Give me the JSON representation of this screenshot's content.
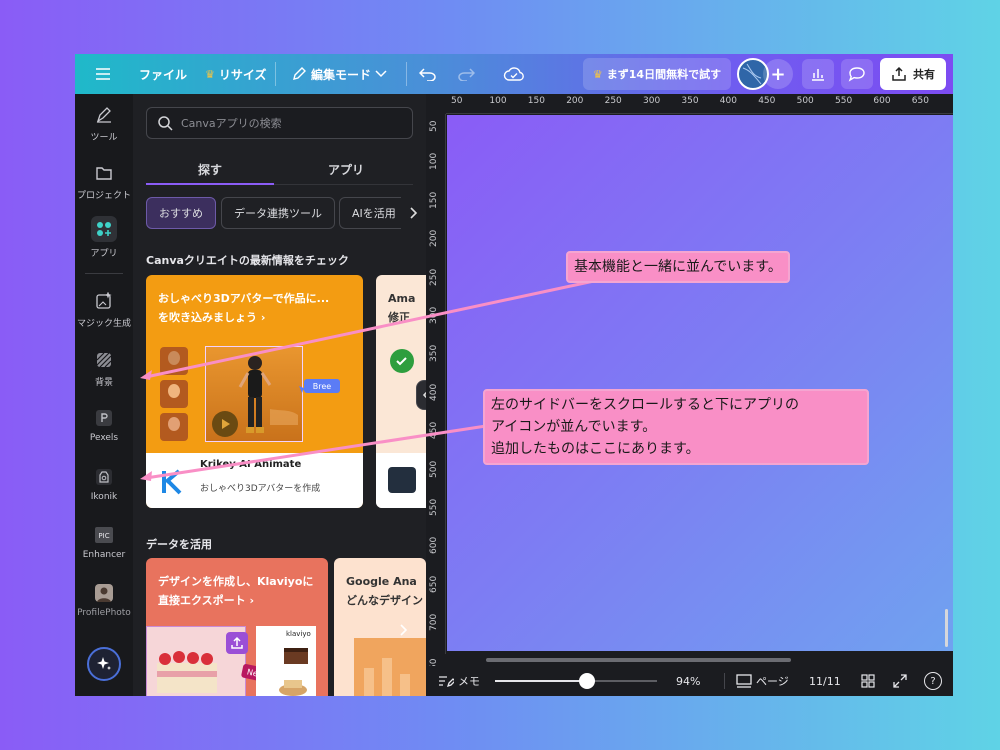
{
  "topbar": {
    "file_label": "ファイル",
    "resize_label": "リサイズ",
    "edit_mode_label": "編集モード",
    "trial_label": "まず14日間無料で試す",
    "share_label": "共有",
    "accent_color": "#7d4cf2"
  },
  "rail": {
    "items": [
      {
        "label": "ツール",
        "icon": "pencil-ruler-icon"
      },
      {
        "label": "プロジェクト",
        "icon": "folder-icon"
      },
      {
        "label": "アプリ",
        "icon": "apps-grid-icon"
      },
      {
        "label": "マジック生成",
        "icon": "magic-image-icon"
      },
      {
        "label": "背景",
        "icon": "background-pattern-icon"
      },
      {
        "label": "Pexels",
        "icon": "pexels-icon"
      },
      {
        "label": "Ikonik",
        "icon": "ikonik-icon"
      },
      {
        "label": "Enhancer",
        "icon": "enhancer-icon"
      },
      {
        "label": "ProfilePhoto",
        "icon": "profile-photo-icon"
      }
    ]
  },
  "panel": {
    "search_placeholder": "Canvaアプリの検索",
    "tabs": [
      "探す",
      "アプリ"
    ],
    "chips": [
      "おすすめ",
      "データ連携ツール",
      "AIを活用"
    ],
    "section1_title": "Canvaクリエイトの最新情報をチェック",
    "card1": {
      "headline_line1": "おしゃべり3Dアバターで作品に...",
      "headline_line2": "を吹き込みましょう ›",
      "badge": "Bree",
      "app_name": "Krikey AI Animate",
      "app_desc": "おしゃべり3Dアバターを作成"
    },
    "card2": {
      "headline_line1": "Ama",
      "headline_line2": "修正"
    },
    "section2_title": "データを活用",
    "card3": {
      "headline_line1": "デザインを作成し、Klaviyoに",
      "headline_line2": "直接エクスポート ›",
      "tag": "Ned",
      "brand": "klaviyo"
    },
    "card4": {
      "headline_line1": "Google Ana",
      "headline_line2": "どんなデザイン"
    }
  },
  "ruler": {
    "top": [
      "50",
      "100",
      "150",
      "200",
      "250",
      "300",
      "350",
      "400",
      "450",
      "500",
      "550",
      "600",
      "650"
    ],
    "left": [
      "50",
      "100",
      "150",
      "200",
      "250",
      "300",
      "350",
      "400",
      "450",
      "500",
      "550",
      "600",
      "650",
      "700",
      "50"
    ]
  },
  "bottombar": {
    "notes_label": "メモ",
    "zoom": "94%",
    "zoom_fraction": 0.57,
    "pages_label": "ページ",
    "page_counter": "11/11",
    "help": "?"
  },
  "callouts": {
    "top": "基本機能と一緒に並んでいます。",
    "bottom_line1": "左のサイドバーをスクロールすると下にアプリの",
    "bottom_line2": "アイコンが並んでいます。",
    "bottom_line3": "追加したものはここにあります。",
    "color": "#f98fc6"
  }
}
